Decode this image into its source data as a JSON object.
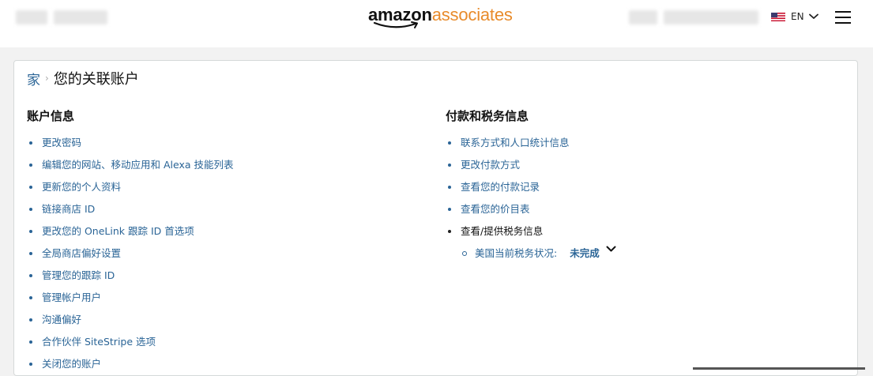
{
  "header": {
    "logo_primary": "amazon",
    "logo_secondary": "associates",
    "language": "EN",
    "brand_color": "#e88b2b"
  },
  "breadcrumb": {
    "home": "家",
    "current": "您的关联账户"
  },
  "account_info": {
    "title": "账户信息",
    "links": [
      "更改密码",
      "编辑您的网站、移动应用和 Alexa 技能列表",
      "更新您的个人资料",
      "链接商店 ID",
      "更改您的 OneLink 跟踪 ID 首选项",
      "全局商店偏好设置",
      "管理您的跟踪 ID",
      "管理帐户用户",
      "沟通偏好",
      "合作伙伴 SiteStripe 选项",
      "关闭您的账户"
    ]
  },
  "payment_info": {
    "title": "付款和税务信息",
    "links": [
      "联系方式和人口统计信息",
      "更改付款方式",
      "查看您的付款记录",
      "查看您的价目表"
    ],
    "tax_item": "查看/提供税务信息",
    "tax_status_label": "美国当前税务状况:",
    "tax_status_value": "未完成"
  },
  "colors": {
    "link": "#2a6496",
    "page_background": "#f2f2f2"
  }
}
